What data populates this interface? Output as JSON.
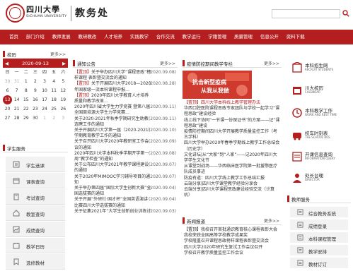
{
  "header": {
    "logo_cn": "四川大學",
    "logo_en": "SICHUAN UNIVERSITY",
    "dept": "教务处",
    "search_placeholder": ""
  },
  "nav": [
    "首页",
    "部门介绍",
    "教师发展",
    "教研教改",
    "人才培养",
    "实践教学",
    "合作交流",
    "教学运行",
    "学籍管理",
    "质量管理",
    "信息公开",
    "资料下载"
  ],
  "calendar": {
    "title": "校历",
    "more": "更多>>",
    "current": "2020-09-13",
    "weekdays": [
      "日",
      "一",
      "二",
      "三",
      "四",
      "五",
      "六"
    ],
    "days": [
      {
        "d": "30",
        "cls": "dim"
      },
      {
        "d": "31",
        "cls": "dim"
      },
      {
        "d": "1",
        "cls": ""
      },
      {
        "d": "2",
        "cls": ""
      },
      {
        "d": "3",
        "cls": ""
      },
      {
        "d": "4",
        "cls": ""
      },
      {
        "d": "5",
        "cls": ""
      },
      {
        "d": "6",
        "cls": ""
      },
      {
        "d": "7",
        "cls": ""
      },
      {
        "d": "8",
        "cls": ""
      },
      {
        "d": "9",
        "cls": ""
      },
      {
        "d": "10",
        "cls": ""
      },
      {
        "d": "11",
        "cls": ""
      },
      {
        "d": "12",
        "cls": ""
      },
      {
        "d": "13",
        "cls": "today"
      },
      {
        "d": "14",
        "cls": ""
      },
      {
        "d": "15",
        "cls": ""
      },
      {
        "d": "16",
        "cls": ""
      },
      {
        "d": "17",
        "cls": ""
      },
      {
        "d": "18",
        "cls": ""
      },
      {
        "d": "19",
        "cls": ""
      },
      {
        "d": "20",
        "cls": ""
      },
      {
        "d": "21",
        "cls": ""
      },
      {
        "d": "22",
        "cls": ""
      },
      {
        "d": "23",
        "cls": ""
      },
      {
        "d": "24",
        "cls": ""
      },
      {
        "d": "25",
        "cls": ""
      },
      {
        "d": "26",
        "cls": ""
      },
      {
        "d": "27",
        "cls": ""
      },
      {
        "d": "28",
        "cls": ""
      },
      {
        "d": "29",
        "cls": ""
      },
      {
        "d": "30",
        "cls": ""
      },
      {
        "d": "1",
        "cls": "dim"
      },
      {
        "d": "2",
        "cls": "dim"
      },
      {
        "d": "3",
        "cls": "dim"
      }
    ]
  },
  "student": {
    "title": "学生服务",
    "items": [
      "学生选课",
      "课表查询",
      "考试查询",
      "教室查询",
      "成绩查询",
      "教学日历",
      "选修教材"
    ]
  },
  "notice": {
    "title": "通知公告",
    "more": "更多>>",
    "tag": "【置顶】",
    "items": [
      {
        "tag": true,
        "text": "关于举办四川大学“课程思政”榜样课程 表彰暨交流会的通知",
        "date": "(2020.09.08)"
      },
      {
        "tag": true,
        "text": "关于开展四川大学2018—2020年国家级一流本科课程申报…",
        "date": "(2020.08.28)"
      },
      {
        "tag": true,
        "text": "2020年四川大学教育人才培养质量和教学改革…",
        "date": ""
      },
      {
        "tag": false,
        "text": "2020年四川省大学生力学竞赛 暨第八届全国周培源大学生力学竞赛…",
        "date": "(2020.09.11)"
      },
      {
        "tag": false,
        "text": "关于2020-2021年秋季学期研究生助教选聘工作的通知",
        "date": "(2020.09.11)"
      },
      {
        "tag": false,
        "text": "关于开展四川大学第一届（2020-2021）学期教育教学工作的通知",
        "date": "(2020.09.10)"
      },
      {
        "tag": false,
        "text": "关于召开四川大学2020年教研室工作会议的通知",
        "date": "(2020.09.09)"
      },
      {
        "tag": false,
        "text": "2020年四川大学本科秋季学期开学第一周“教学检查”的通知",
        "date": "(2020.09.08)"
      },
      {
        "tag": false,
        "text": "关于公布四川大学2021年教学课程建设的通知",
        "date": "(2020.09.07)"
      },
      {
        "tag": false,
        "text": "关于2020年MIMOOC学习辅导项目的通知",
        "date": "(2020.09.07)"
      },
      {
        "tag": false,
        "text": "关于举办第四届“国际大学生创新大赛”全国选拔赛的通知",
        "date": "(2020.09.04)"
      },
      {
        "tag": false,
        "text": "关于开展“外研社·国才杯”全国英语演讲比赛四川大学选拔赛的通知",
        "date": "(2020.09.04)"
      },
      {
        "tag": false,
        "text": "关于征集2021年“大学生创新创业训练计划”项目的通知",
        "date": "(2020.09.03)"
      },
      {
        "tag": false,
        "text": "关于2020年全国大学生英语竞赛初赛…",
        "date": "(2020.09.03)"
      }
    ]
  },
  "epidemic": {
    "title": "疫情防控期间教学专栏",
    "more": "更多>>",
    "banner_top": "抗击新型疫病",
    "banner_bottom": "从我从我做",
    "items": [
      "【置顶】四川大学本科线上教学管理办法",
      "华西口腔医院课程思政专家团队与学校一起学习“课程思政”建设经验",
      "线上线下协同“一节课一份保证书”的方案——记“课程思政”建设",
      "疫情防控期间四川大学开展教学质量监控工作（考古学科）",
      "四川大学举办2020年春季学期线上教学工作总结会（历史学）",
      "文化讲坛|从“大家”到“人家”——记2020年四川大学学生文化节",
      "从课堂到战场——华西临床医学院第一批援鄂医疗队成员事迹",
      "防疫有道：四川大学线上教学工作总结汇报",
      "云端分享|四川大学课堂教学经验分享会",
      "云端分享|四川大学课程思政建设经验交流（计算机）"
    ]
  },
  "news": {
    "title": "新闻报道",
    "more": "更多>>",
    "items": [
      "【置顶】我校召开首批通识教育核心课程表彰大会",
      "我校荣获全国高等学校教学成果奖",
      "学校隆重召开课程思政榜样课程表彰暨交流会",
      "四川大学2020年研究生复试工作会议召开",
      "学校召开教学质量监控工作会议"
    ]
  },
  "quick": [
    {
      "t1": "本科招生网",
      "t2": "RECRUIT STUDENTS",
      "icon": "recruit-icon"
    },
    {
      "t1": "川大校历",
      "t2": "CALENDAR",
      "icon": "calendar-icon"
    },
    {
      "t1": "本科教学工作",
      "t2": "WORK AND REST TIME",
      "icon": "work-icon"
    },
    {
      "t1": "校车时刻表",
      "t2": "THE SCHOOL BUS",
      "icon": "bus-icon"
    },
    {
      "t1": "开课信息查询",
      "t2": "INFORMATION QUERY",
      "icon": "query-icon"
    },
    {
      "t1": "处长台理",
      "t2": "DIRECTOR",
      "icon": "director-icon"
    }
  ],
  "teacher": {
    "title": "教师服务",
    "items": [
      "综合教务系统",
      "成绩登录",
      "本科课程管理",
      "教学安排",
      "教材订订"
    ]
  },
  "colors": {
    "primary": "#b41e1e",
    "panel_bg": "#f2f2f2"
  }
}
